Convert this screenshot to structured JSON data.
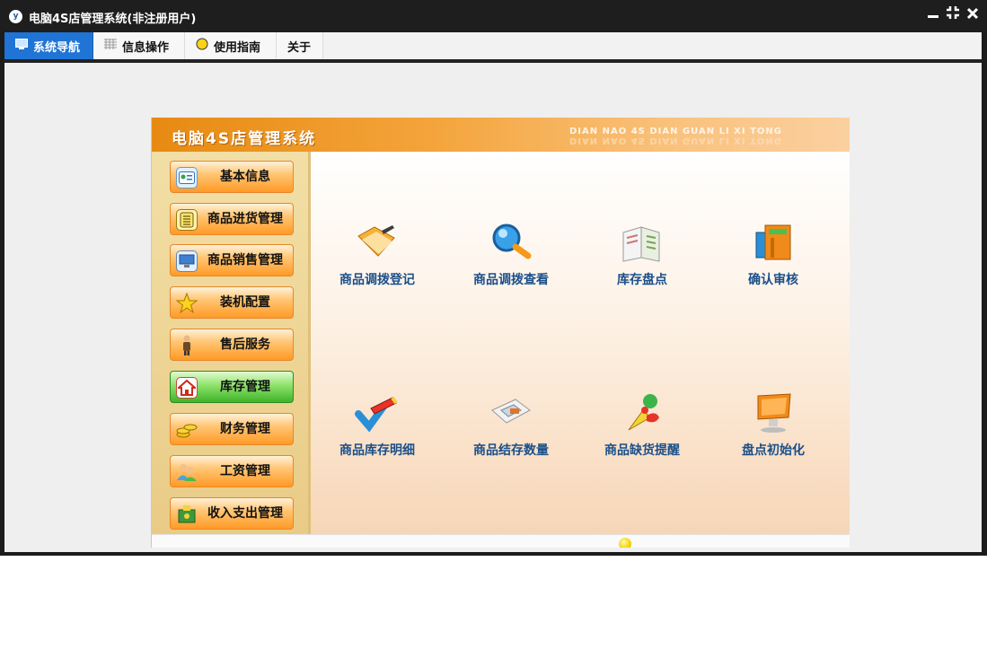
{
  "window": {
    "title": "电脑4S店管理系统(非注册用户)",
    "app_icon_glyph": "y",
    "controls": {
      "minimize": "▁",
      "restore": "⋄",
      "close": "✕"
    }
  },
  "menu": {
    "tabs": [
      {
        "label": "系统导航",
        "icon": "monitor-icon",
        "active": true
      },
      {
        "label": "信息操作",
        "icon": "grid-icon",
        "active": false
      },
      {
        "label": "使用指南",
        "icon": "help-bulb-icon",
        "active": false
      },
      {
        "label": "关于",
        "active": false
      }
    ]
  },
  "banner": {
    "title": "电脑4S店管理系统",
    "pinyin": "DIAN NAO 4S DIAN GUAN LI XI TONG"
  },
  "sidebar": {
    "items": [
      {
        "label": "基本信息",
        "icon": "id-card-icon"
      },
      {
        "label": "商品进货管理",
        "icon": "document-stack-icon"
      },
      {
        "label": "商品销售管理",
        "icon": "computer-icon"
      },
      {
        "label": "装机配置",
        "icon": "star-icon"
      },
      {
        "label": "售后服务",
        "icon": "person-icon"
      },
      {
        "label": "库存管理",
        "icon": "house-icon",
        "active": true
      },
      {
        "label": "财务管理",
        "icon": "coins-icon"
      },
      {
        "label": "工资管理",
        "icon": "users-icon"
      },
      {
        "label": "收入支出管理",
        "icon": "money-box-icon"
      }
    ]
  },
  "functions": [
    {
      "label": "商品调拨登记",
      "icon": "folder-pencil-icon"
    },
    {
      "label": "商品调拨查看",
      "icon": "magnifier-icon"
    },
    {
      "label": "库存盘点",
      "icon": "open-book-icon"
    },
    {
      "label": "确认审核",
      "icon": "archive-binder-icon"
    },
    {
      "label": "商品库存明细",
      "icon": "check-pencil-icon"
    },
    {
      "label": "商品结存数量",
      "icon": "blueprint-icon"
    },
    {
      "label": "商品缺货提醒",
      "icon": "megaphone-icon"
    },
    {
      "label": "盘点初始化",
      "icon": "monitor-screen-icon"
    }
  ],
  "colors": {
    "title_bar": "#1e1e1e",
    "active_tab": "#1f74d6",
    "banner_orange": "#e78a12",
    "active_side_green": "#3eb32a",
    "function_label": "#1b4f8a"
  }
}
